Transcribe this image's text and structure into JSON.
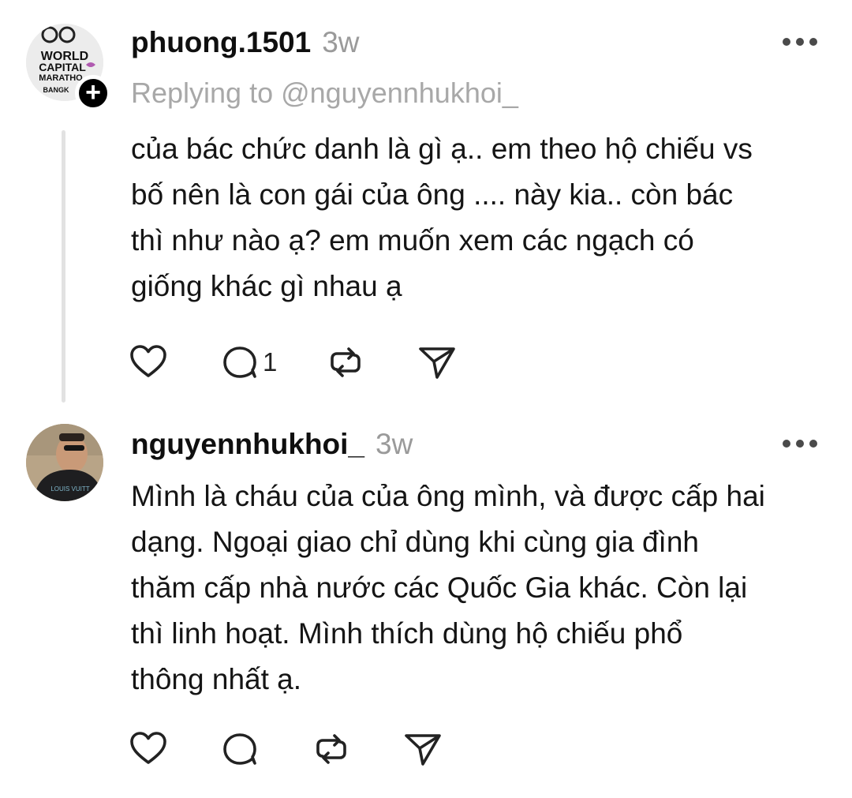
{
  "posts": [
    {
      "username": "phuong.1501",
      "time": "3w",
      "reply_to": "Replying to @nguyennhukhoi_",
      "avatar_text": [
        "WORLD",
        "CAPITAL",
        "MARATHO",
        "BANGK"
      ],
      "lines": [
        "của bác chức danh là gì ạ.. em theo hộ chiếu vs",
        "bố nên là con gái của ông .... này kia.. còn bác",
        "thì như nào ạ? em muốn xem các ngạch có",
        "giống khác gì nhau ạ"
      ],
      "comment_count": "1"
    },
    {
      "username": "nguyennhukhoi_",
      "time": "3w",
      "shirt_text": "LOUIS VUITT",
      "lines": [
        "Mình là cháu của của ông mình, và được cấp hai",
        "dạng. Ngoại giao chỉ dùng khi cùng gia đình",
        "thăm cấp nhà nước các Quốc Gia khác. Còn lại",
        "thì linh hoạt. Mình thích dùng hộ chiếu phổ",
        "thông nhất ạ."
      ]
    }
  ],
  "icons": {
    "like": "heart-icon",
    "comment": "comment-bubble-icon",
    "repost": "repost-icon",
    "share": "send-icon",
    "more": "more-dots-icon",
    "follow": "plus-icon"
  }
}
